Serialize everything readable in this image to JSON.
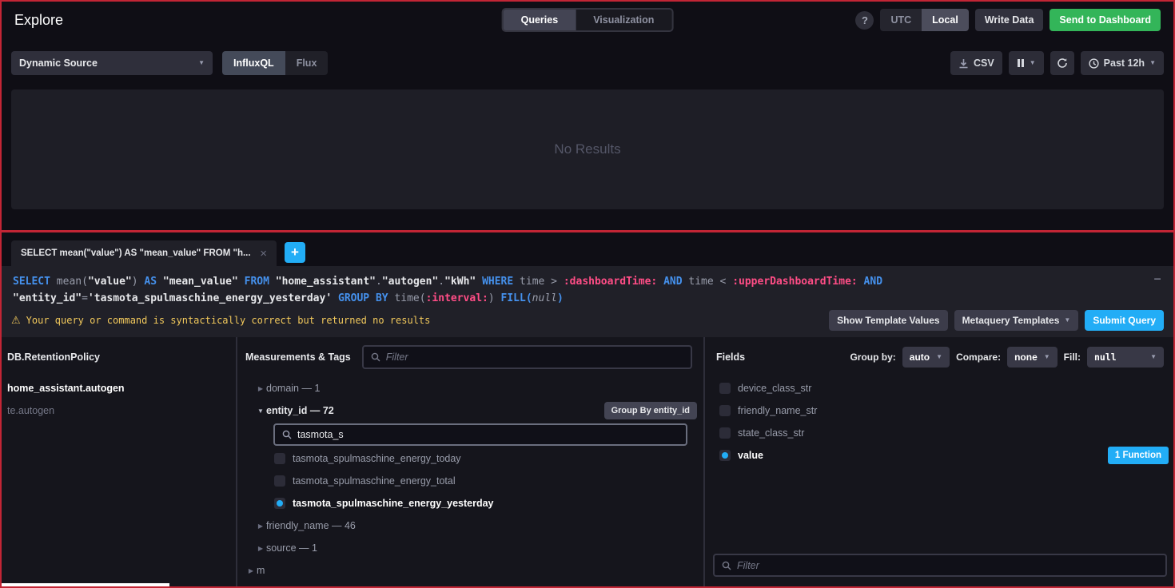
{
  "colors": {
    "blue": "#22adf6",
    "green": "#33b559",
    "yellow": "#f2c95c",
    "red": "#c22535",
    "kw": "#4591ed",
    "tv": "#ff4d86"
  },
  "top_nav": {
    "title": "Explore",
    "queries_label": "Queries",
    "visualization_label": "Visualization",
    "help_label": "?",
    "utc_label": "UTC",
    "local_label": "Local",
    "write_data_label": "Write Data",
    "send_to_dashboard_label": "Send to Dashboard"
  },
  "toolbar": {
    "source_label": "Dynamic Source",
    "influxql_label": "InfluxQL",
    "flux_label": "Flux",
    "csv_label": "CSV",
    "time_range_label": "Past 12h"
  },
  "graph": {
    "empty_text": "No Results"
  },
  "query_tabs": {
    "tab_label": "SELECT mean(\"value\") AS \"mean_value\" FROM \"h...",
    "close_label": "×",
    "add_label": "+"
  },
  "editor": {
    "minimize_label": "—",
    "lines": [
      [
        {
          "c": "kw",
          "t": "SELECT "
        },
        {
          "c": "def",
          "t": "mean("
        },
        {
          "c": "str",
          "t": "\"value\""
        },
        {
          "c": "def",
          "t": ") "
        },
        {
          "c": "kw",
          "t": "AS "
        },
        {
          "c": "str",
          "t": "\"mean_value\""
        },
        {
          "c": "def",
          "t": " "
        },
        {
          "c": "kw",
          "t": "FROM "
        },
        {
          "c": "str",
          "t": "\"home_assistant\""
        },
        {
          "c": "def",
          "t": "."
        },
        {
          "c": "str",
          "t": "\"autogen\""
        },
        {
          "c": "def",
          "t": "."
        },
        {
          "c": "str",
          "t": "\"kWh\""
        },
        {
          "c": "def",
          "t": " "
        },
        {
          "c": "kw",
          "t": "WHERE "
        },
        {
          "c": "def",
          "t": "time > "
        },
        {
          "c": "tv",
          "t": ":dashboardTime:"
        },
        {
          "c": "kw",
          "t": " AND "
        },
        {
          "c": "def",
          "t": "time < "
        },
        {
          "c": "tv",
          "t": ":upperDashboardTime:"
        },
        {
          "c": "kw",
          "t": " AND"
        }
      ],
      [
        {
          "c": "str",
          "t": "\"entity_id\""
        },
        {
          "c": "def",
          "t": "="
        },
        {
          "c": "str",
          "t": "'tasmota_spulmaschine_energy_yesterday'"
        },
        {
          "c": "def",
          "t": " "
        },
        {
          "c": "kw",
          "t": "GROUP BY "
        },
        {
          "c": "def",
          "t": "time("
        },
        {
          "c": "tv",
          "t": ":interval:"
        },
        {
          "c": "def",
          "t": ") "
        },
        {
          "c": "kw",
          "t": "FILL("
        },
        {
          "c": "nul",
          "t": "null"
        },
        {
          "c": "kw",
          "t": ")"
        }
      ]
    ]
  },
  "status": {
    "warning_text": "Your query or command is syntactically correct but returned no results",
    "show_template_values_label": "Show Template Values",
    "metaquery_templates_label": "Metaquery Templates",
    "submit_label": "Submit Query"
  },
  "builder": {
    "db": {
      "header": "DB.RetentionPolicy",
      "items": [
        {
          "label": "home_assistant.autogen",
          "active": true
        },
        {
          "label": "te.autogen",
          "active": false
        }
      ]
    },
    "measurements": {
      "header": "Measurements & Tags",
      "filter_placeholder": "Filter",
      "domain_label": "domain — 1",
      "entity_label": "entity_id — 72",
      "group_by_button": "Group By entity_id",
      "tag_search_value": "tasmota_s",
      "values": [
        {
          "label": "tasmota_spulmaschine_energy_today",
          "checked": false
        },
        {
          "label": "tasmota_spulmaschine_energy_total",
          "checked": false
        },
        {
          "label": "tasmota_spulmaschine_energy_yesterday",
          "checked": true
        }
      ],
      "friendly_label": "friendly_name — 46",
      "source_label": "source — 1",
      "next_measurement_label": "m"
    },
    "fields": {
      "header": "Fields",
      "group_by_label": "Group by:",
      "group_by_value": "auto",
      "compare_label": "Compare:",
      "compare_value": "none",
      "fill_label": "Fill:",
      "fill_value": "null",
      "items": [
        {
          "label": "device_class_str",
          "checked": false
        },
        {
          "label": "friendly_name_str",
          "checked": false
        },
        {
          "label": "state_class_str",
          "checked": false
        },
        {
          "label": "value",
          "checked": true,
          "badge": "1 Function"
        }
      ],
      "filter_placeholder": "Filter"
    }
  }
}
